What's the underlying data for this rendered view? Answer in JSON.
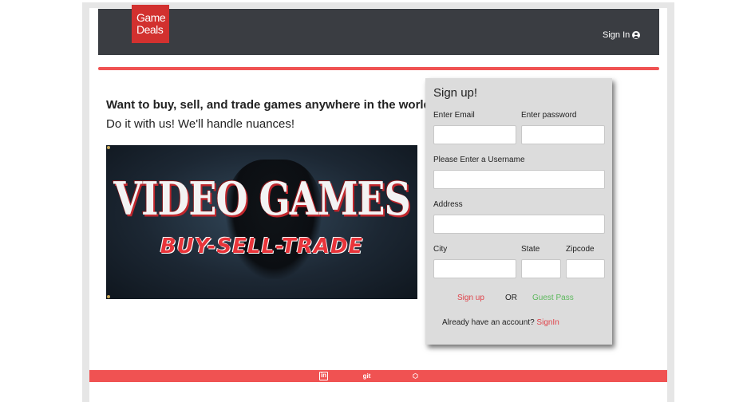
{
  "header": {
    "logo_line1": "Game",
    "logo_line2": "Deals",
    "signin_label": "Sign In"
  },
  "hero": {
    "headline": "Want to buy, sell, and trade games anywhere in the world?",
    "subline": "Do it with us! We'll handle nuances!",
    "banner_title": "VIDEO GAMES",
    "banner_subtitle": "BUY-SELL-TRADE"
  },
  "signup": {
    "title": "Sign up!",
    "email_label": "Enter Email",
    "password_label": "Enter password",
    "username_label": "Please Enter a Username",
    "address_label": "Address",
    "city_label": "City",
    "state_label": "State",
    "zipcode_label": "Zipcode",
    "email_value": "",
    "password_value": "",
    "username_value": "",
    "address_value": "",
    "city_value": "",
    "state_value": "",
    "zipcode_value": "",
    "signup_button": "Sign up",
    "or_text": "OR",
    "guest_button": "Guest Pass",
    "already_text": "Already have an account?",
    "signin_link": "SignIn"
  },
  "footer": {
    "linkedin_icon_text": "in",
    "git_icon_text": "git",
    "codepen_icon_text": "⬡"
  },
  "colors": {
    "accent": "#f05252",
    "navbar": "#3a3d42",
    "logo": "#d2312f",
    "guest": "#5cb85c"
  }
}
